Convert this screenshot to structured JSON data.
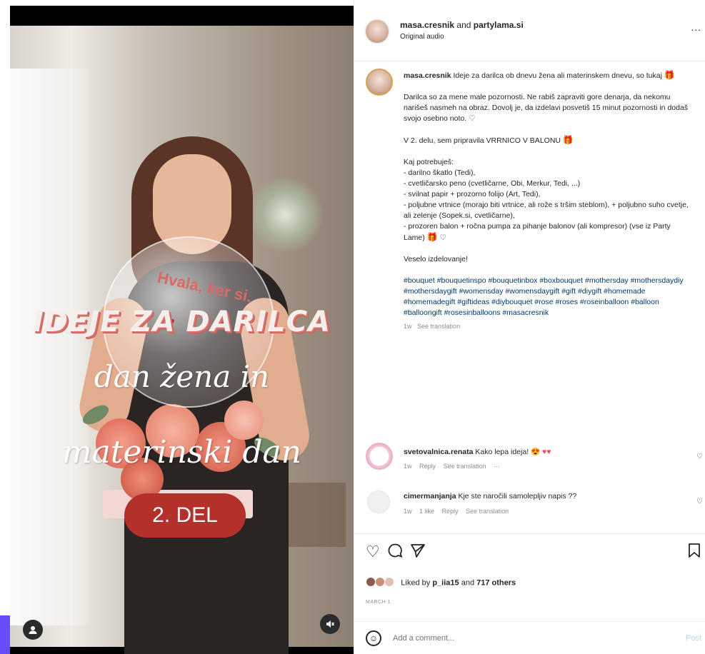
{
  "video": {
    "title_line": "IDEJE ZA DARILCA",
    "script_line1": "dan žena in",
    "script_line2": "materinski dan",
    "part_label": "2. DEL",
    "balloon_text": "Hvala, ker si.",
    "icons": {
      "user": "user-icon",
      "mute": "mute-icon"
    }
  },
  "header": {
    "author": "masa.cresnik",
    "and_text": "and",
    "coauthor": "partylama.si",
    "audio": "Original audio",
    "more": "..."
  },
  "caption": {
    "author": "masa.cresnik",
    "intro": "Ideje za darilca ob dnevu žena ali materinskem dnevu, so tukaj",
    "p1": "Darilca so za mene male pozornosti. Ne rabiš zapraviti gore denarja, da nekomu narišeš nasmeh na obraz. Dovolj je, da izdelavi posvetiš 15 minut pozornosti in dodaš svojo osebno noto.",
    "p2": "V 2. delu, sem pripravila VRRNICO V BALONU",
    "p3_head": "Kaj potrebuješ:",
    "items": [
      "- darilno škatlo (Tedi),",
      "- cvetličarsko peno (cvetličarne, Obi, Merkur, Tedi, ...)",
      "- svilnat papir + prozorno folijo (Art, Tedi),",
      "- poljubne vrtnice (morajo biti vrtnice, ali rože s tršim steblom), + poljubno suho cvetje, ali zelenje (Sopek.si, cvetličarne),",
      "- prozoren balon + ročna pumpa za pihanje balonov (ali kompresor) (vse iz Party Lame)"
    ],
    "closing": "Veselo izdelovanje!",
    "hashtags": "#bouquet #bouquetinspo #bouquetinbox #boxbouquet #mothersday #mothersdaydiy #mothersdaygift #womensday #womensdaygift #gift #diygift #homemade #homemadegift #giftideas #diybouquet #rose #roses #roseinballoon #balloon #balloongift #rosesinballoons #masacresnik",
    "time": "1w",
    "see_translation": "See translation"
  },
  "comments": [
    {
      "user": "svetovalnica.renata",
      "text": "Kako lepa ideja!",
      "time": "1w",
      "likes": "",
      "reply": "Reply",
      "see_translation": "See translation",
      "more": "···"
    },
    {
      "user": "cimermanjanja",
      "text": "Kje ste naročili samolepljiv napis ??",
      "time": "1w",
      "likes": "1 like",
      "reply": "Reply",
      "see_translation": "See translation"
    }
  ],
  "actions": {
    "liked_by_prefix": "Liked by",
    "liked_by_user": "p_iia15",
    "liked_by_and": "and",
    "liked_by_others": "717 others",
    "date": "MARCH 1"
  },
  "add_comment": {
    "placeholder": "Add a comment...",
    "post": "Post"
  },
  "colors": {
    "accent_blue": "#0095f6",
    "hashtag": "#00376b",
    "pill_red": "#b4302a",
    "purple_strip": "#6a4cff"
  }
}
